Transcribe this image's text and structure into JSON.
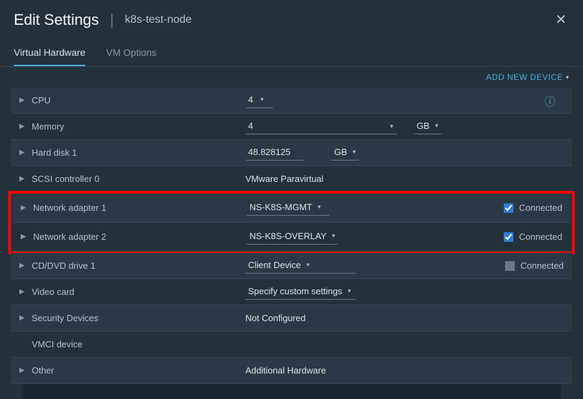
{
  "header": {
    "title": "Edit Settings",
    "subtitle": "k8s-test-node"
  },
  "tabs": {
    "virtual_hardware": "Virtual Hardware",
    "vm_options": "VM Options"
  },
  "actions": {
    "add_device": "ADD NEW DEVICE"
  },
  "rows": {
    "cpu": {
      "label": "CPU",
      "value": "4"
    },
    "memory": {
      "label": "Memory",
      "value": "4",
      "unit": "GB"
    },
    "hard_disk": {
      "label": "Hard disk 1",
      "value": "48.828125",
      "unit": "GB"
    },
    "scsi": {
      "label": "SCSI controller 0",
      "value": "VMware Paravirtual"
    },
    "net1": {
      "label": "Network adapter 1",
      "value": "NS-K8S-MGMT",
      "connected": "Connected"
    },
    "net2": {
      "label": "Network adapter 2",
      "value": "NS-K8S-OVERLAY",
      "connected": "Connected"
    },
    "cddvd": {
      "label": "CD/DVD drive 1",
      "value": "Client Device",
      "connected": "Connected"
    },
    "video": {
      "label": "Video card",
      "value": "Specify custom settings"
    },
    "security": {
      "label": "Security Devices",
      "value": "Not Configured"
    },
    "vmci": {
      "label": "VMCI device"
    },
    "other": {
      "label": "Other",
      "value": "Additional Hardware"
    }
  }
}
